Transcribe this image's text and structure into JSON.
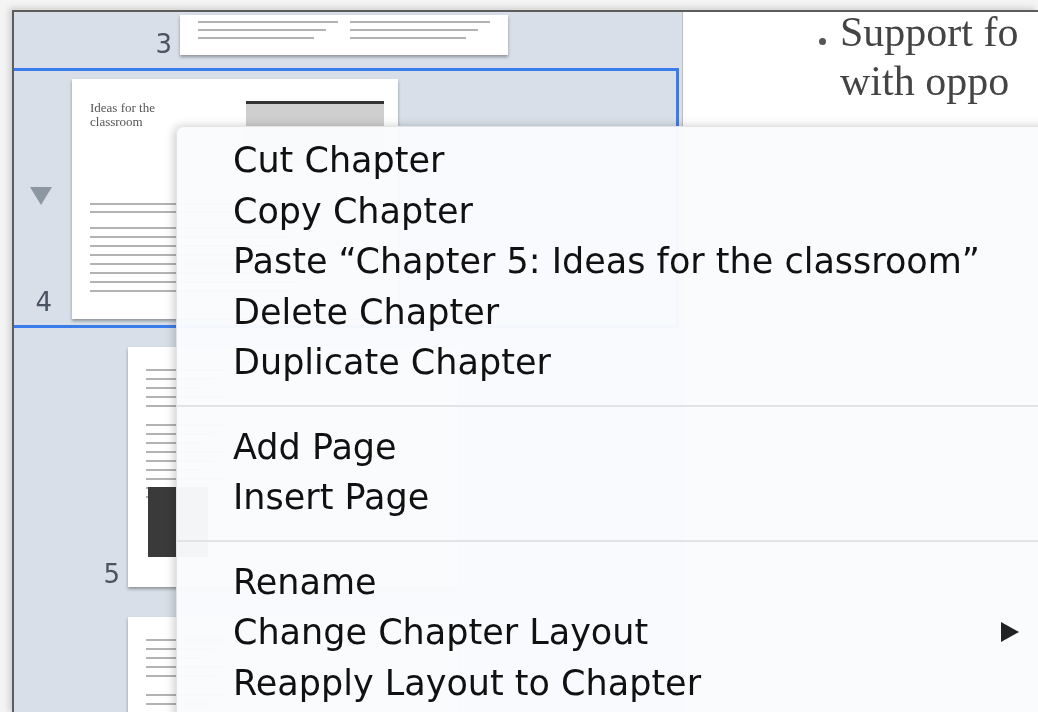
{
  "sidebar": {
    "items": [
      {
        "kind": "page",
        "number": "3",
        "selected": false
      },
      {
        "kind": "chapter",
        "number": "4",
        "selected": true,
        "expanded": true,
        "title": "Ideas for the classroom",
        "children": [
          {
            "number": "5",
            "selected": false
          },
          {
            "selected": false
          }
        ]
      }
    ]
  },
  "document": {
    "bullets": [
      {
        "lines": [
          "Support fo",
          "with oppo"
        ]
      }
    ]
  },
  "context_menu": {
    "sections": [
      {
        "items": [
          {
            "label": "Cut Chapter",
            "submenu": false
          },
          {
            "label": "Copy Chapter",
            "submenu": false
          },
          {
            "label": "Paste “Chapter 5: Ideas for the classroom”",
            "submenu": false
          },
          {
            "label": "Delete Chapter",
            "submenu": false
          },
          {
            "label": "Duplicate Chapter",
            "submenu": false
          }
        ]
      },
      {
        "items": [
          {
            "label": "Add Page",
            "submenu": false
          },
          {
            "label": "Insert Page",
            "submenu": false
          }
        ]
      },
      {
        "items": [
          {
            "label": "Rename",
            "submenu": false
          },
          {
            "label": "Change Chapter Layout",
            "submenu": true
          },
          {
            "label": "Reapply Layout to Chapter",
            "submenu": false
          }
        ]
      }
    ]
  }
}
